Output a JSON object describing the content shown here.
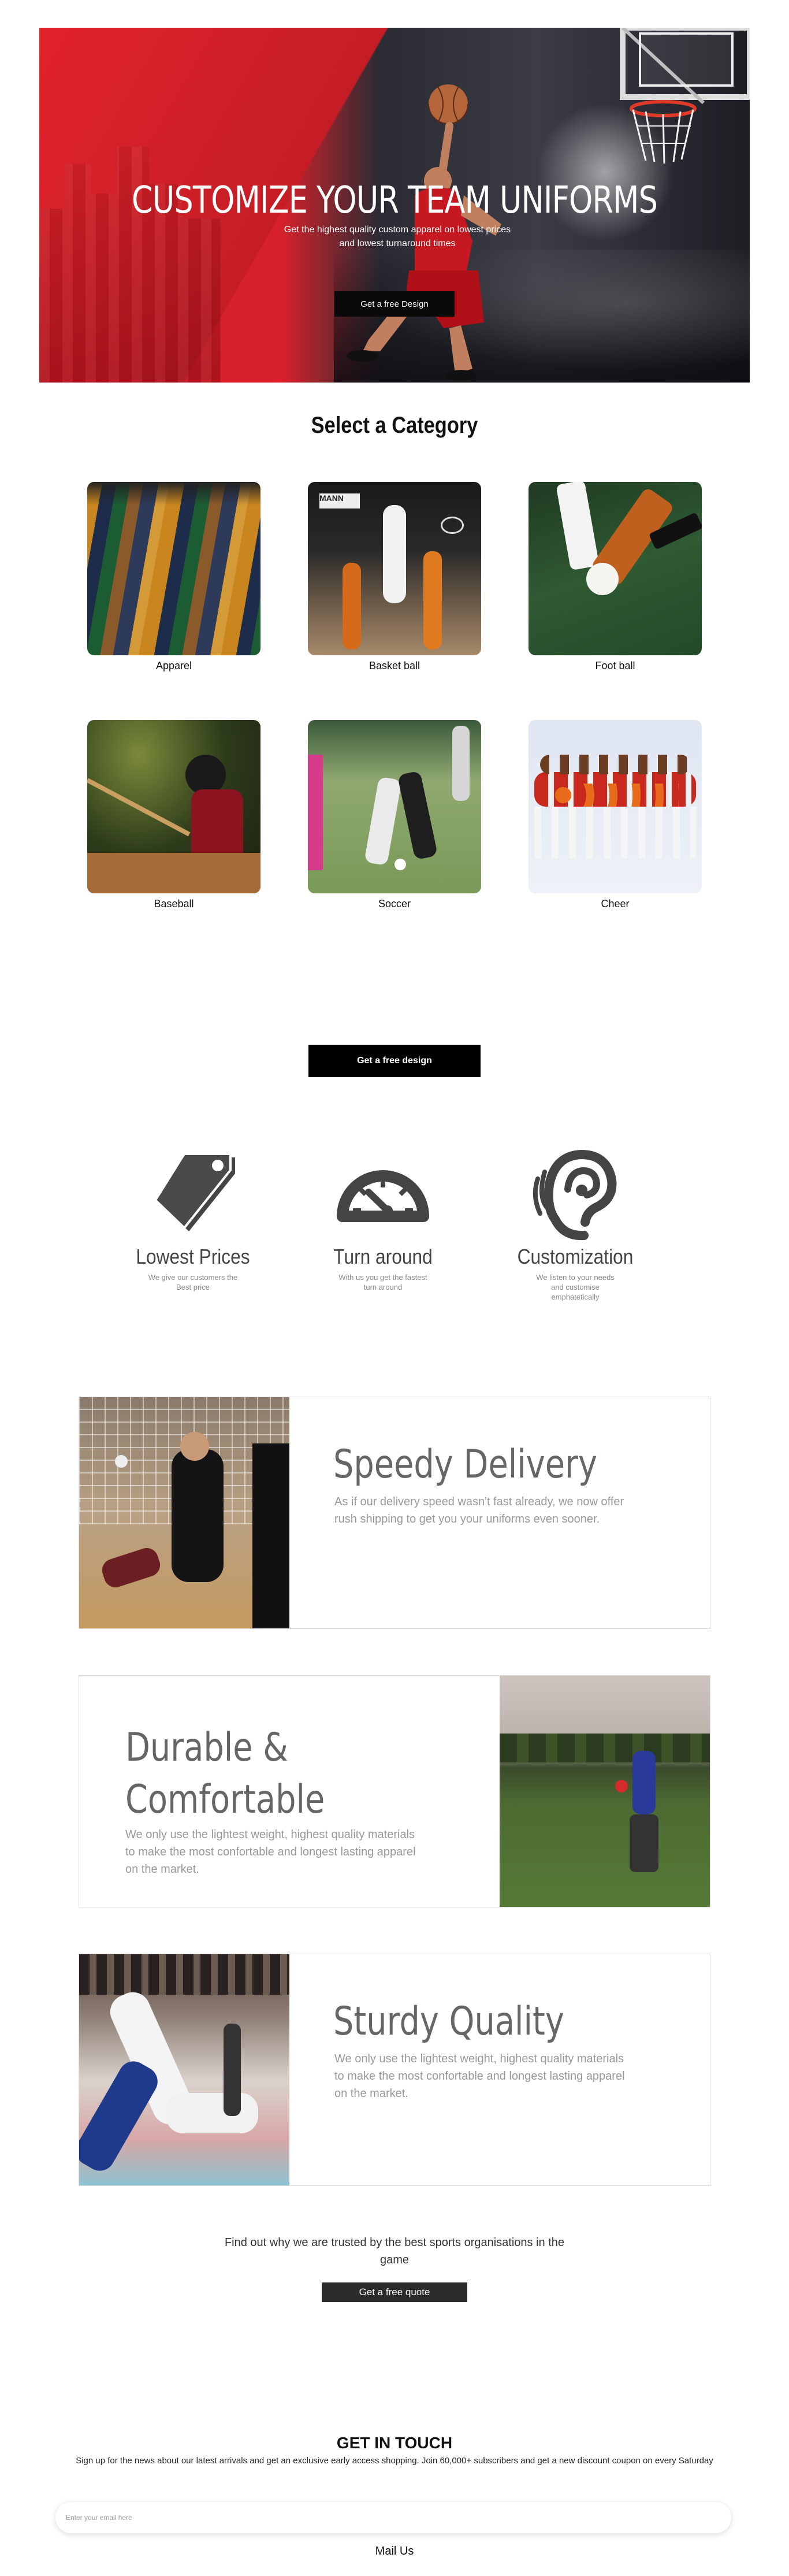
{
  "hero": {
    "title": "CUSTOMIZE YOUR TEAM UNIFORMS",
    "subtitle": "Get the highest quality custom apparel on lowest prices and lowest turnaround times",
    "button": "Get a free Design"
  },
  "category": {
    "title": "Select a Category",
    "items": [
      {
        "label": "Apparel"
      },
      {
        "label": "Basket ball"
      },
      {
        "label": "Foot ball"
      },
      {
        "label": "Baseball"
      },
      {
        "label": "Soccer"
      },
      {
        "label": "Cheer"
      }
    ],
    "button": "Get a free design"
  },
  "features": [
    {
      "icon": "price-tag-icon",
      "name": "Lowest Prices",
      "desc": "We give our customers the Best price"
    },
    {
      "icon": "speedometer-icon",
      "name": "Turn around",
      "desc": "With us you get the fastest turn around"
    },
    {
      "icon": "ear-icon",
      "name": "Customization",
      "desc": "We listen to your needs and customise emphatetically"
    }
  ],
  "blocks": [
    {
      "title": "Speedy Delivery",
      "text": "As if our delivery speed wasn't fast already, we now offer rush shipping to get you your uniforms even sooner."
    },
    {
      "title_line1": "Durable &",
      "title_line2": "Comfortable",
      "text": "We only use the lightest weight, highest quality materials to make the most confortable and longest lasting apparel on the market."
    },
    {
      "title": "Sturdy Quality",
      "text": "We only use the lightest weight, highest quality materials to make the most confortable and longest lasting apparel on the market."
    }
  ],
  "trust": {
    "text": "Find out why we are trusted by the best sports organisations in the game",
    "button": "Get a free quote"
  },
  "contact": {
    "title": "GET IN TOUCH",
    "subtitle": "Sign up for the news about our latest arrivals and get an exclusive early access shopping. Join 60,000+ subscribers and get a new discount coupon on every Saturday",
    "email_placeholder": "Enter your email here",
    "mail_us": "Mail Us"
  },
  "colors": {
    "accent_red": "#d7212a",
    "button_black": "#000000",
    "icon_gray": "#444444"
  }
}
